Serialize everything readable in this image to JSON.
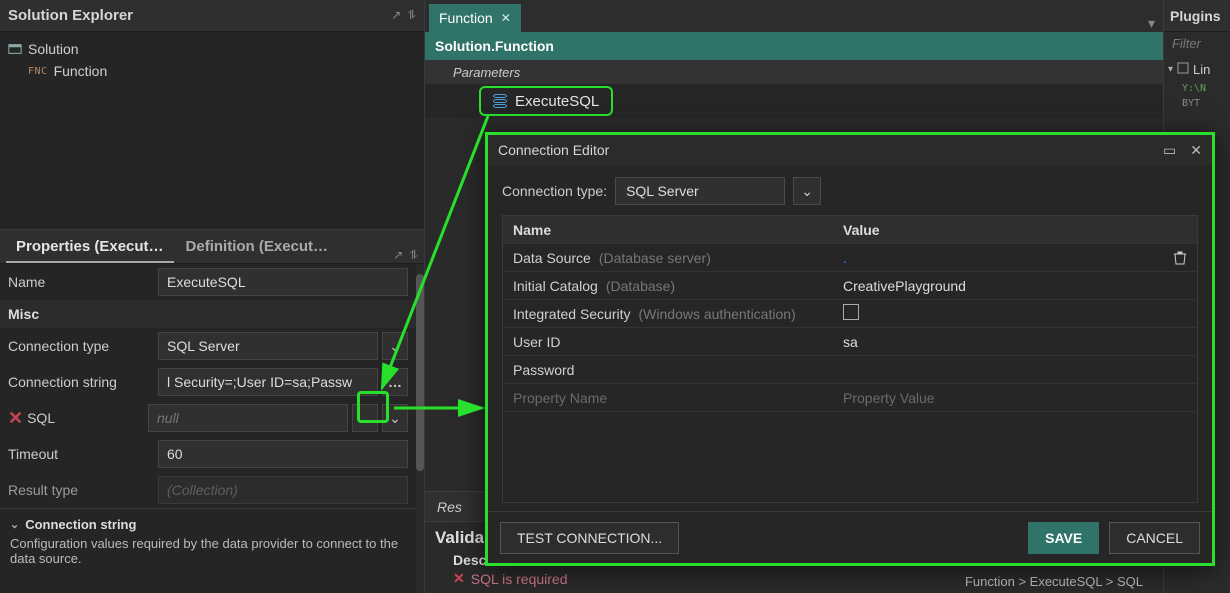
{
  "solution_explorer": {
    "title": "Solution Explorer",
    "root": "Solution",
    "child_tag": "FNC",
    "child": "Function"
  },
  "props": {
    "tab_properties": "Properties (Execut…",
    "tab_definition": "Definition (Execut…",
    "name_label": "Name",
    "name_value": "ExecuteSQL",
    "misc_header": "Misc",
    "conn_type_label": "Connection type",
    "conn_type_value": "SQL Server",
    "conn_string_label": "Connection string",
    "conn_string_value": "l Security=;User ID=sa;Passw",
    "sql_label": "SQL",
    "sql_value": "null",
    "timeout_label": "Timeout",
    "timeout_value": "60",
    "result_type_label": "Result type",
    "result_type_value": "(Collection)",
    "desc_title": "Connection string",
    "desc_text": "Configuration values required by the data provider to connect to the data source."
  },
  "center": {
    "tab_label": "Function",
    "breadcrumb": "Solution.Function",
    "params_label": "Parameters",
    "execute_label": "ExecuteSQL",
    "result_label": "Res",
    "validation_title": "Valida",
    "validation_desc": "Desc",
    "validation_err": "SQL is required",
    "validation_path": "Function > ExecuteSQL > SQL"
  },
  "plugins": {
    "title": "Plugins",
    "filter_placeholder": "Filter",
    "item": "Lin",
    "sub1": "Y:\\N",
    "sub2": "BYT"
  },
  "modal": {
    "title": "Connection Editor",
    "conn_type_label": "Connection type:",
    "conn_type_value": "SQL Server",
    "col_name": "Name",
    "col_value": "Value",
    "rows": {
      "data_source": {
        "name": "Data Source",
        "hint": "(Database server)",
        "value": "."
      },
      "initial_catalog": {
        "name": "Initial Catalog",
        "hint": "(Database)",
        "value": "CreativePlayground"
      },
      "integrated_security": {
        "name": "Integrated Security",
        "hint": "(Windows authentication)"
      },
      "user_id": {
        "name": "User ID",
        "value": "sa"
      },
      "password": {
        "name": "Password"
      },
      "placeholder_name": "Property Name",
      "placeholder_value": "Property Value"
    },
    "test_btn": "TEST CONNECTION...",
    "save_btn": "SAVE",
    "cancel_btn": "CANCEL"
  }
}
